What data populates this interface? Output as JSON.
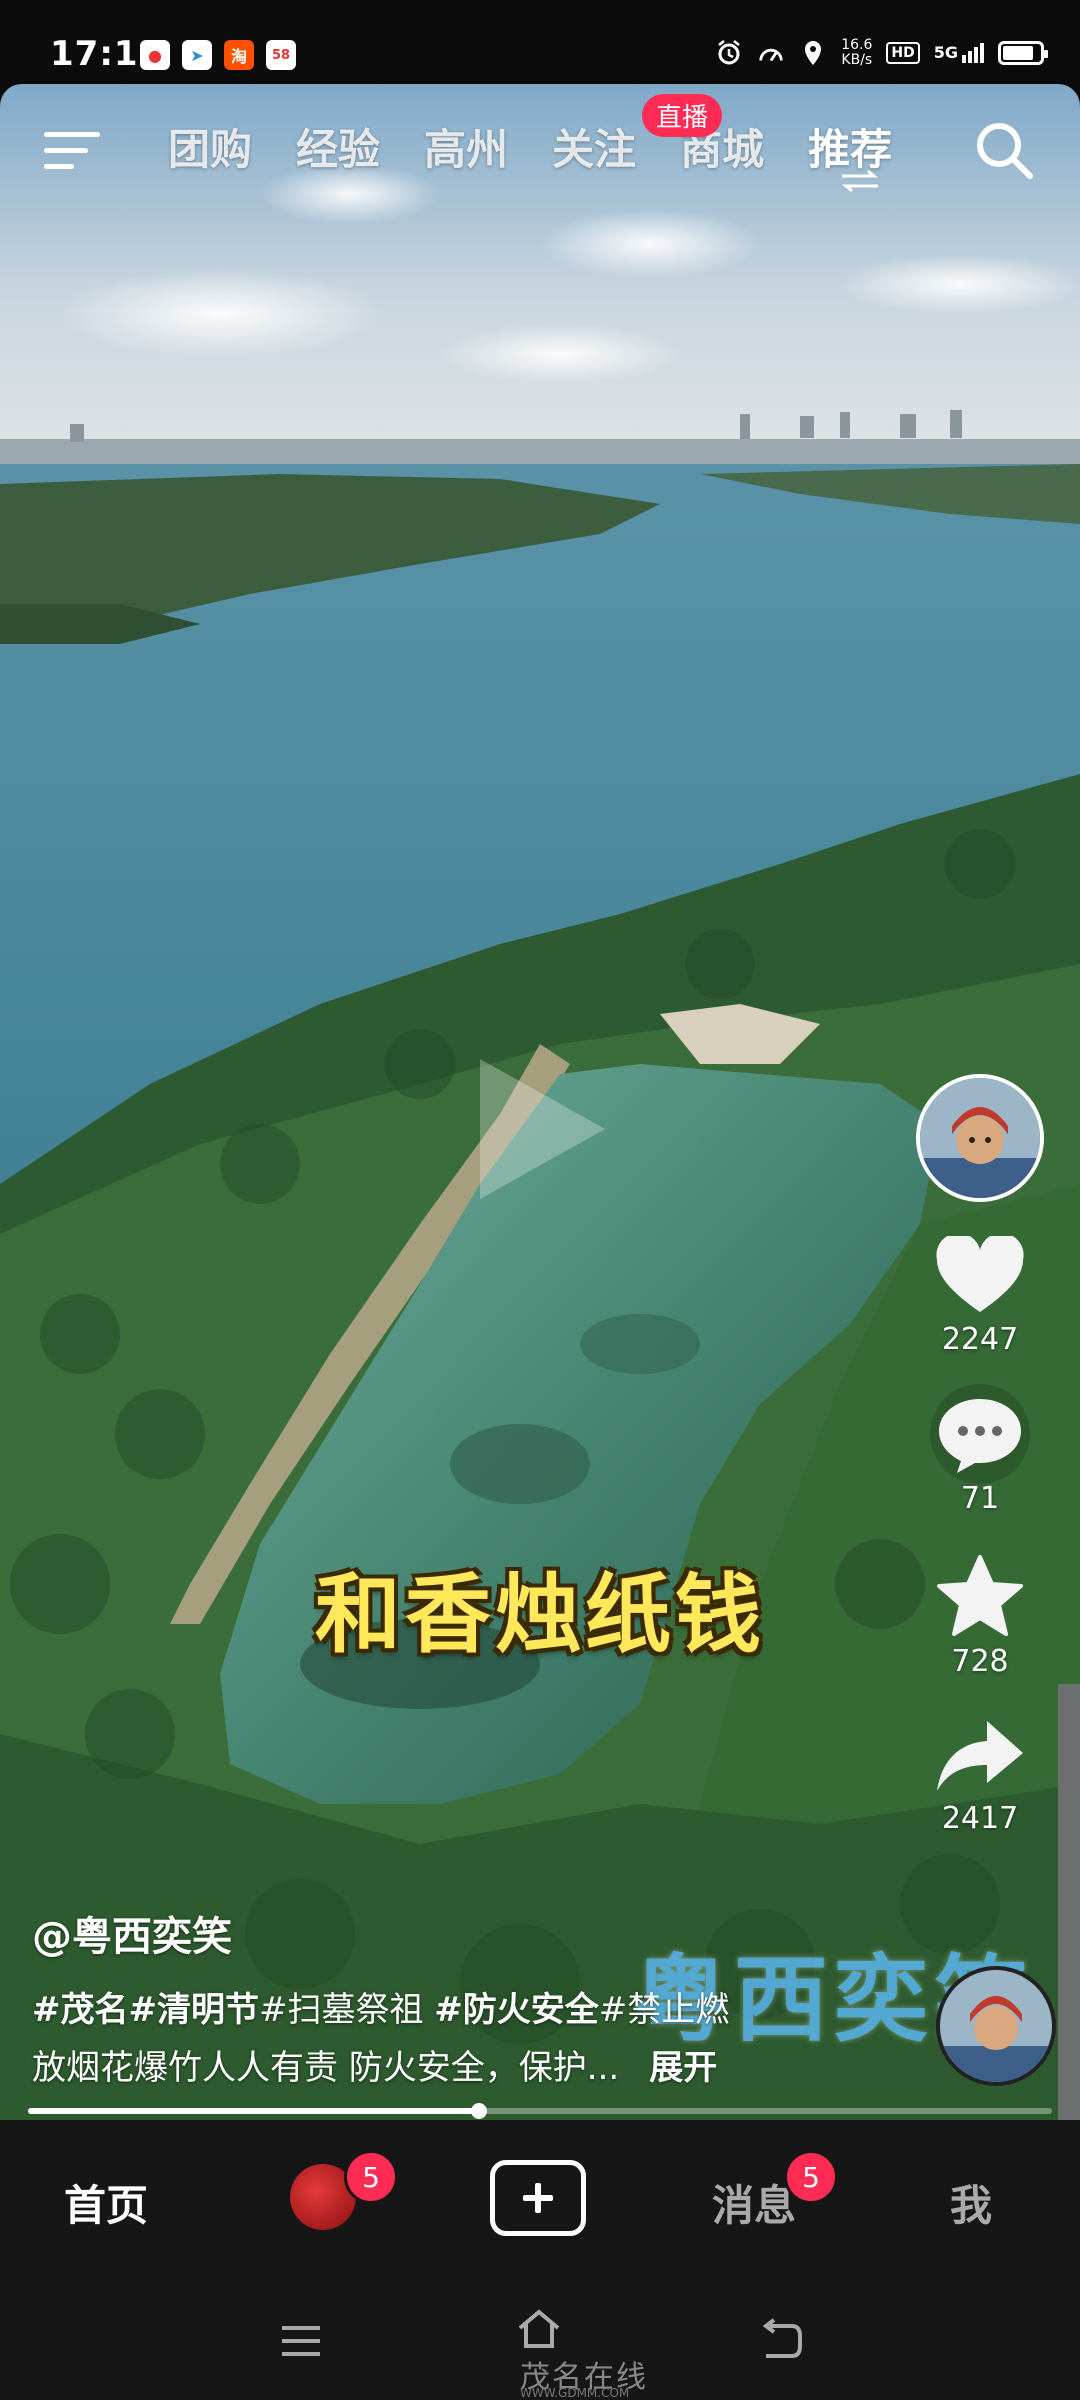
{
  "status_bar": {
    "time": "17:14",
    "network_speed": "16.6",
    "network_unit": "KB/s",
    "hd_label": "HD",
    "signal_label": "5G",
    "battery_level": 0.85,
    "app_icons": [
      "location-app-icon",
      "telegram-icon",
      "taobao-icon",
      "58-icon"
    ]
  },
  "top_nav": {
    "tabs": [
      {
        "label": "团购"
      },
      {
        "label": "经验"
      },
      {
        "label": "高州"
      },
      {
        "label": "关注"
      },
      {
        "label": "商城"
      },
      {
        "label": "推荐"
      }
    ],
    "active_tab": "推荐",
    "live_badge": "直播"
  },
  "video": {
    "caption": "和香烛纸钱",
    "author": "@粤西奕笑",
    "tags_bold_1": "#茂名#清明节",
    "tags_1": "#扫墓祭祖 ",
    "tags_bold_2": "#防火安全",
    "tags_2": "#禁止燃",
    "description": "放烟花爆竹人人有责 防火安全，保护...",
    "expand_label": "展开",
    "watermark": "粤西奕笑",
    "progress": 0.44
  },
  "actions": {
    "likes": "2247",
    "comments": "71",
    "favorites": "728",
    "shares": "2417"
  },
  "bottom_nav": {
    "home": "首页",
    "friends_badge": "5",
    "messages": "消息",
    "messages_badge": "5",
    "me": "我"
  },
  "system_nav": {
    "site_logo": "茂名在线",
    "site_url": "WWW.GDMM.COM"
  },
  "colors": {
    "accent": "#fe2c55",
    "caption": "#ffe95a",
    "watermark": "#5ec0ff"
  }
}
